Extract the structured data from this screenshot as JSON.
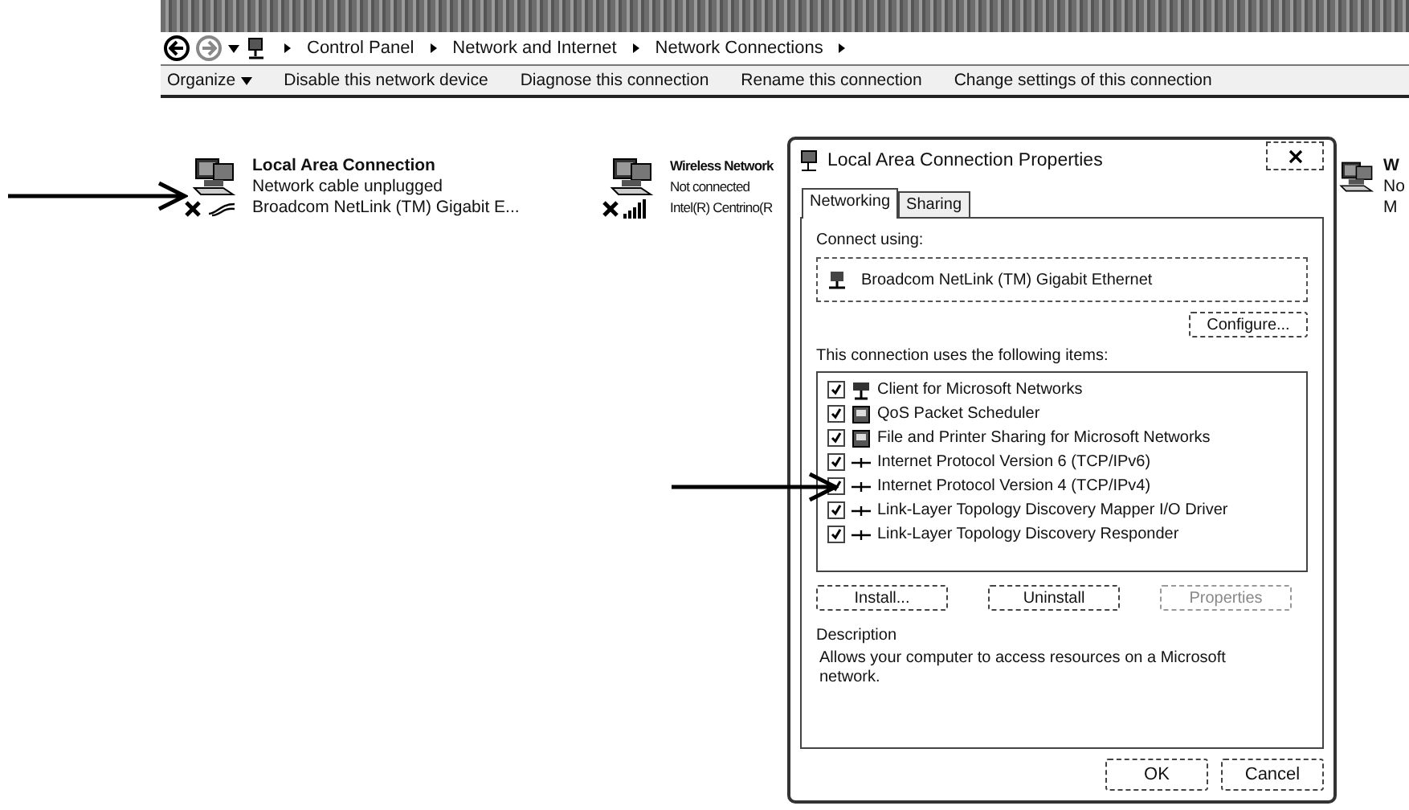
{
  "explorer": {
    "breadcrumb": [
      "Control Panel",
      "Network and Internet",
      "Network Connections"
    ],
    "toolbar": [
      {
        "label": "Organize",
        "kind": "menu"
      },
      {
        "label": "Disable this network device",
        "kind": "command"
      },
      {
        "label": "Diagnose this connection",
        "kind": "command"
      },
      {
        "label": "Rename this connection",
        "kind": "command"
      },
      {
        "label": "Change settings of this connection",
        "kind": "command"
      }
    ],
    "connections": [
      {
        "name": "Local Area Connection",
        "status": "Network cable unplugged",
        "adapter": "Broadcom NetLink (TM) Gigabit E...",
        "kind": "wired"
      },
      {
        "name": "Wireless Network",
        "status": "Not connected",
        "adapter": "Intel(R) Centrino(R",
        "kind": "wireless"
      },
      {
        "name": "W",
        "status": "No",
        "adapter": "M",
        "kind": "wireless"
      }
    ]
  },
  "dialog": {
    "title": "Local Area Connection Properties",
    "tabs": [
      {
        "label": "Networking",
        "selected": true
      },
      {
        "label": "Sharing",
        "selected": false
      }
    ],
    "connect_using_label": "Connect using:",
    "adapter": "Broadcom NetLink (TM) Gigabit Ethernet",
    "configure_button": "Configure...",
    "items_label": "This connection uses the following items:",
    "items": [
      {
        "label": "Client for Microsoft Networks",
        "checked": true,
        "kind": "client"
      },
      {
        "label": "QoS Packet Scheduler",
        "checked": true,
        "kind": "service"
      },
      {
        "label": "File and Printer Sharing for Microsoft Networks",
        "checked": true,
        "kind": "service"
      },
      {
        "label": "Internet Protocol Version 6 (TCP/IPv6)",
        "checked": true,
        "kind": "protocol"
      },
      {
        "label": "Internet Protocol Version 4 (TCP/IPv4)",
        "checked": true,
        "kind": "protocol"
      },
      {
        "label": "Link-Layer Topology Discovery Mapper I/O Driver",
        "checked": true,
        "kind": "protocol"
      },
      {
        "label": "Link-Layer Topology Discovery Responder",
        "checked": true,
        "kind": "protocol"
      }
    ],
    "buttons": [
      {
        "label": "Install...",
        "disabled": false
      },
      {
        "label": "Uninstall",
        "disabled": false
      },
      {
        "label": "Properties",
        "disabled": true
      }
    ],
    "description_label": "Description",
    "description": "Allows your computer to access resources on a Microsoft network.",
    "footer_buttons": [
      "OK",
      "Cancel"
    ]
  }
}
